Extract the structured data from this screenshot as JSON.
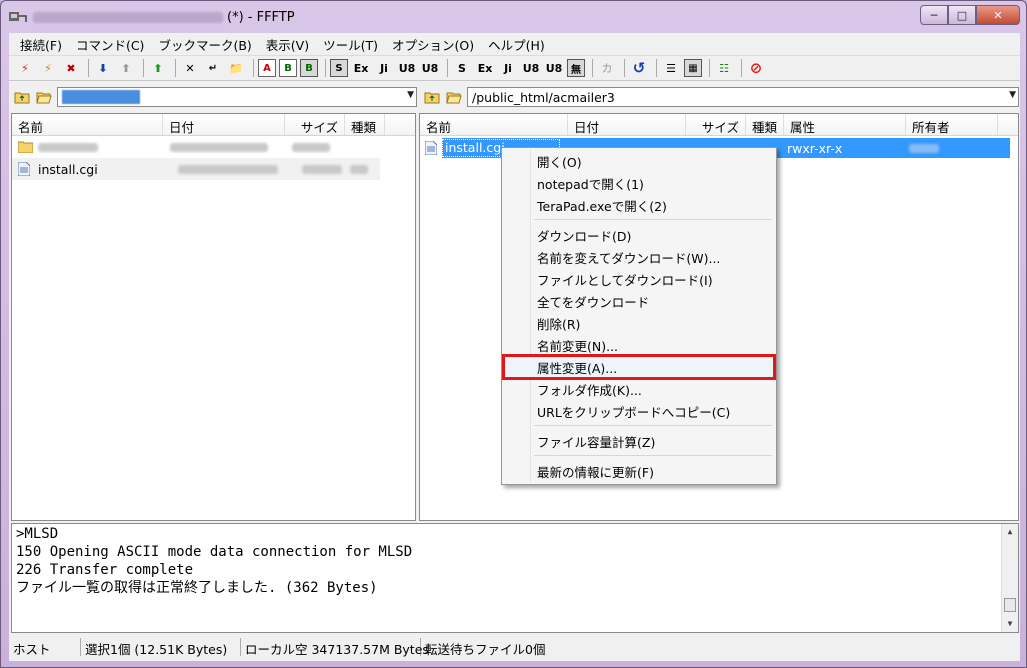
{
  "window": {
    "title": "(*) - FFFTP",
    "title_blurred_prefix": true
  },
  "menubar": [
    "接続(F)",
    "コマンド(C)",
    "ブックマーク(B)",
    "表示(V)",
    "ツール(T)",
    "オプション(O)",
    "ヘルプ(H)"
  ],
  "toolbar": {
    "ascii_labels": [
      "S",
      "Ex",
      "Ji",
      "U8",
      "U8"
    ],
    "ascii_labels2": [
      "S",
      "Ex",
      "Ji",
      "U8",
      "U8"
    ],
    "no_conv": "無",
    "kana": "カ"
  },
  "left_path": {
    "value": ""
  },
  "right_path": {
    "value": "/public_html/acmailer3"
  },
  "left_pane": {
    "columns": [
      "名前",
      "日付",
      "サイズ",
      "種類"
    ],
    "rows": [
      {
        "name": "",
        "type": "folder"
      },
      {
        "name": "install.cgi",
        "type": "file"
      }
    ]
  },
  "right_pane": {
    "columns": [
      "名前",
      "日付",
      "サイズ",
      "種類",
      "属性",
      "所有者"
    ],
    "rows": [
      {
        "name": "install.cgi",
        "attr": "rwxr-xr-x",
        "selected": true
      }
    ]
  },
  "context_menu": {
    "items": [
      "開く(O)",
      "notepadで開く(1)",
      "TeraPad.exeで開く(2)",
      "ダウンロード(D)",
      "名前を変えてダウンロード(W)...",
      "ファイルとしてダウンロード(I)",
      "全てをダウンロード",
      "削除(R)",
      "名前変更(N)...",
      "属性変更(A)...",
      "フォルダ作成(K)...",
      "URLをクリップボードへコピー(C)",
      "ファイル容量計算(Z)",
      "最新の情報に更新(F)"
    ],
    "highlighted_item": "属性変更(A)..."
  },
  "log": {
    "lines": [
      ">MLSD",
      "150 Opening ASCII mode data connection for MLSD",
      "226 Transfer complete",
      "ファイル一覧の取得は正常終了しました. (362 Bytes)"
    ]
  },
  "statusbar": {
    "host": "ホスト",
    "selection": "選択1個 (12.51K Bytes)",
    "local_free": "ローカル空 347137.57M Bytes",
    "queue": "転送待ちファイル0個"
  },
  "colors": {
    "selection": "#3399ff",
    "highlight_border": "#e01818",
    "title_bg": "#c8b2dc"
  }
}
